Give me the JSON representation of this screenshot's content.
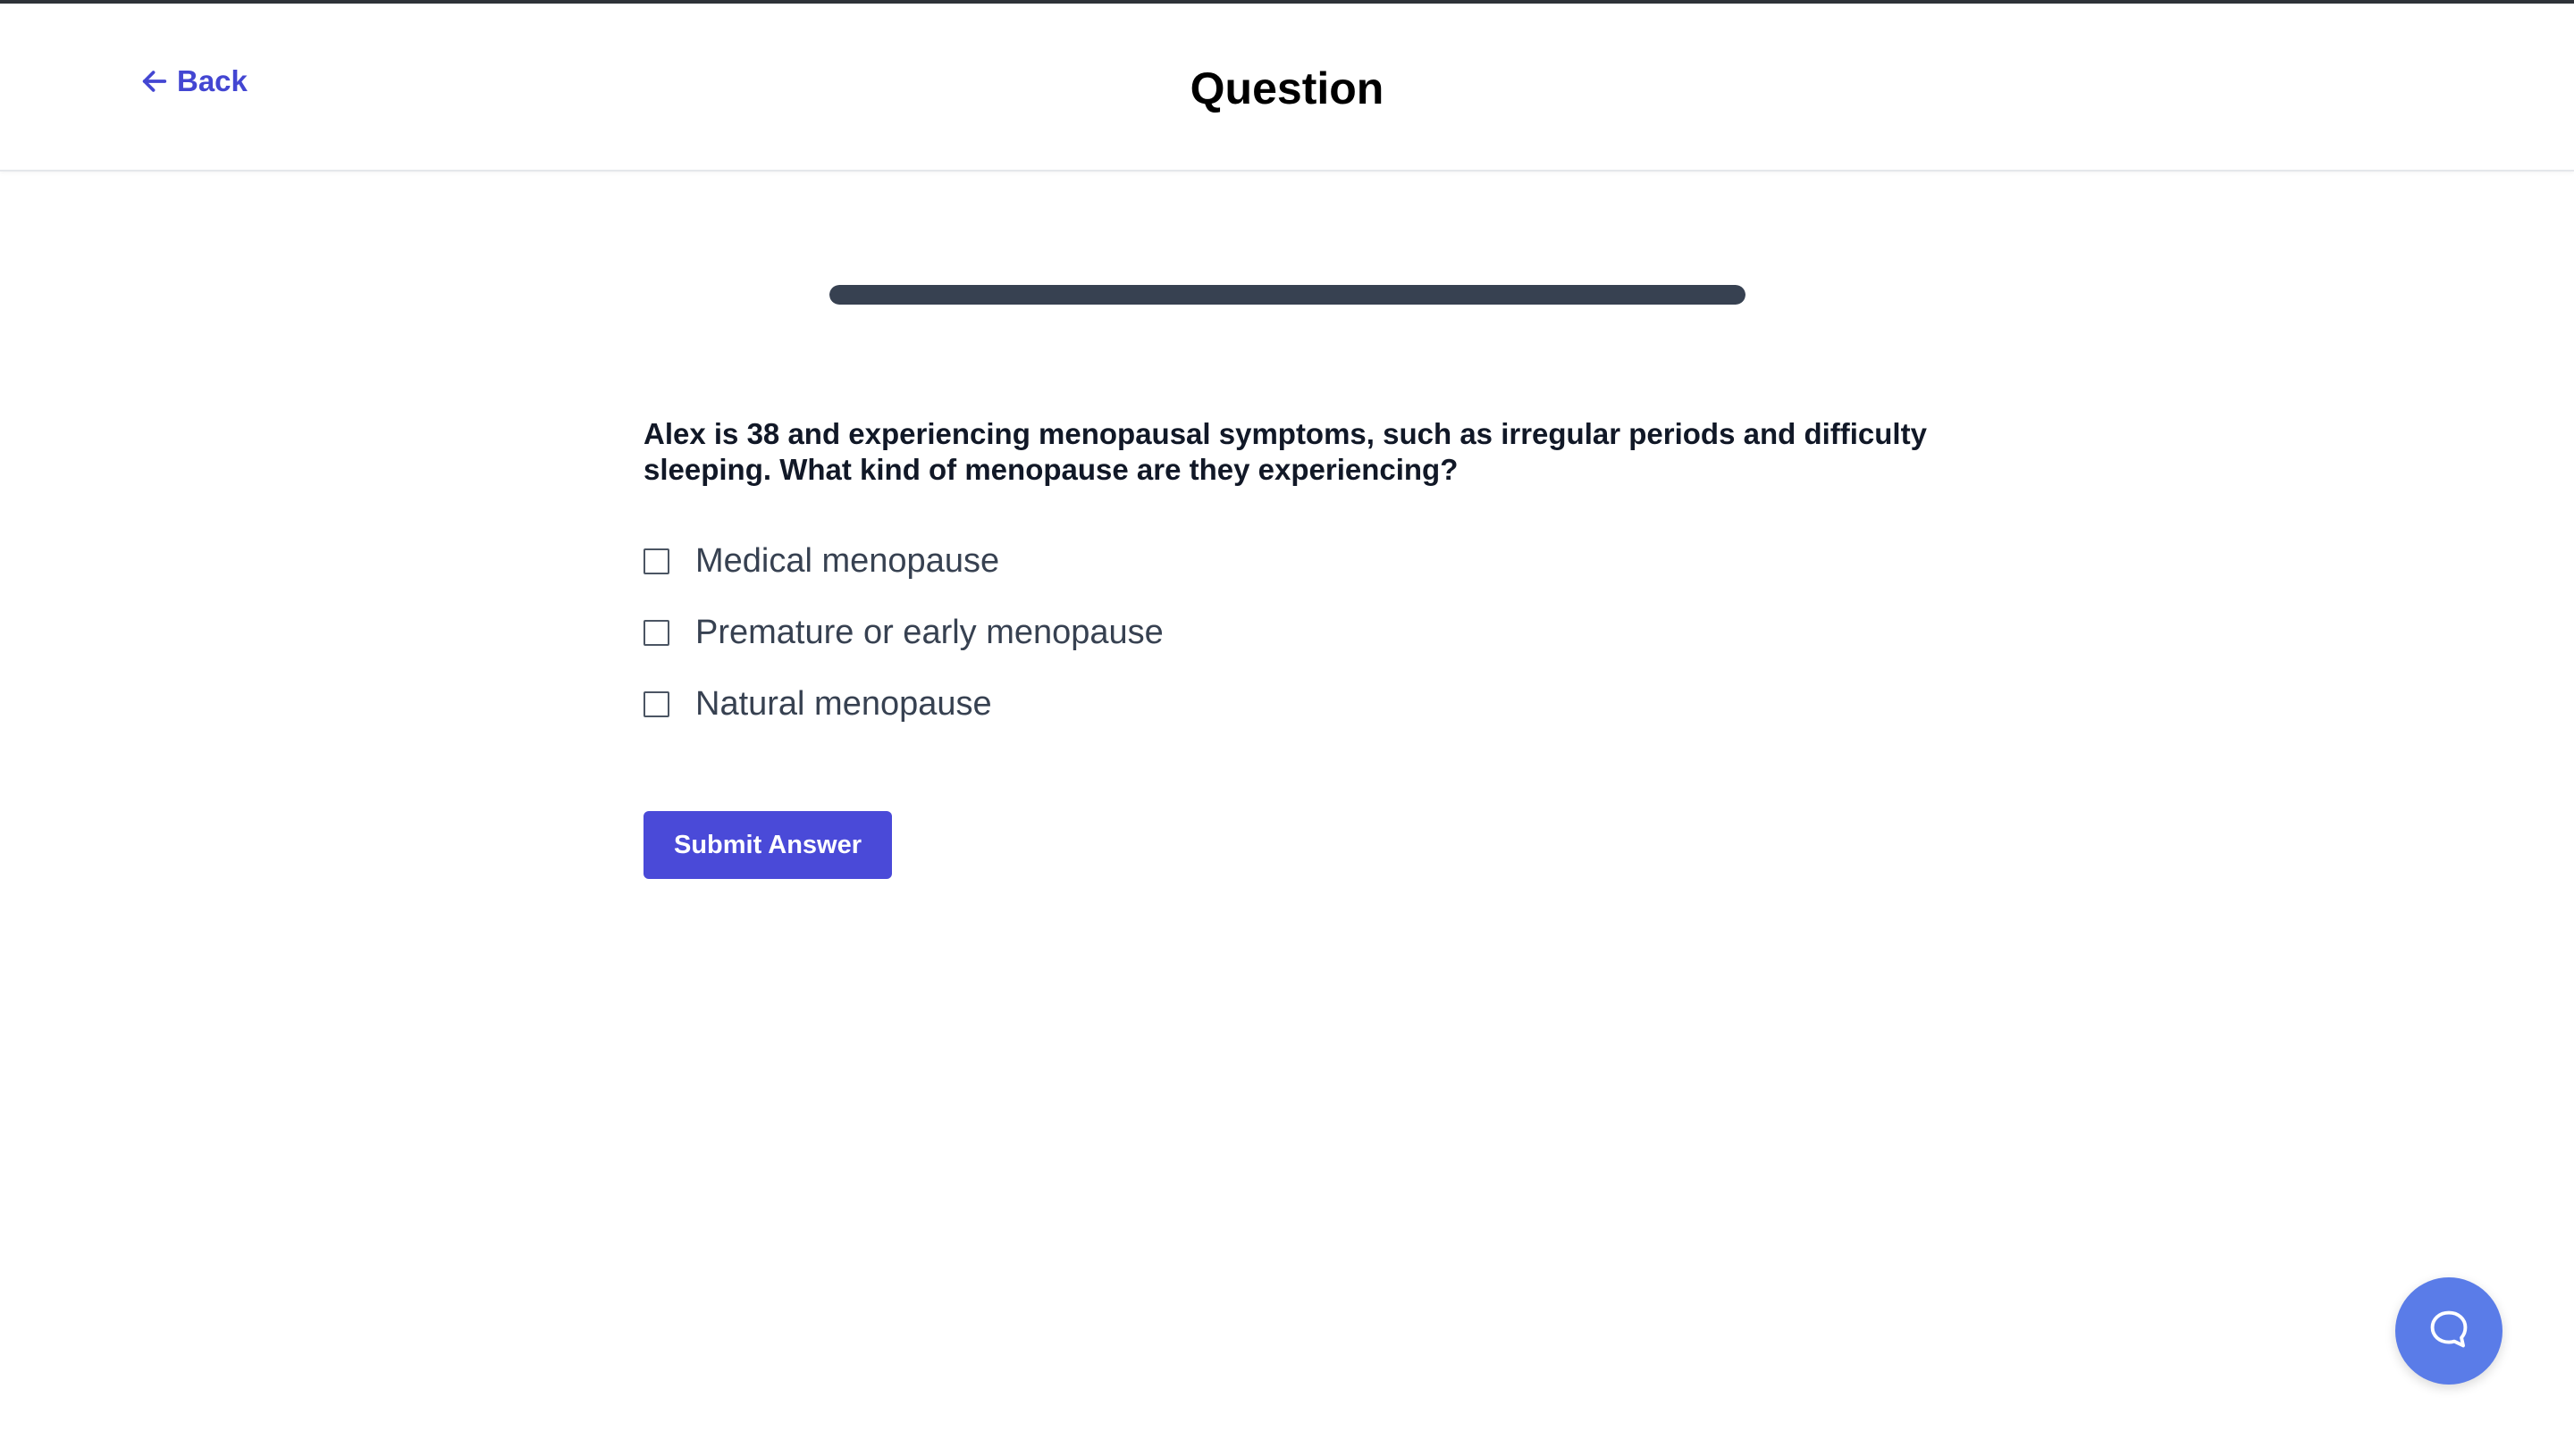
{
  "header": {
    "back_label": "Back",
    "title": "Question"
  },
  "progress": {
    "fraction": 1.0
  },
  "question": {
    "text": "Alex is 38 and experiencing menopausal symptoms, such as irregular periods and difficulty sleeping. What kind of menopause are they experiencing?",
    "options": [
      {
        "label": "Medical menopause",
        "checked": false
      },
      {
        "label": "Premature or early menopause",
        "checked": false
      },
      {
        "label": "Natural menopause",
        "checked": false
      }
    ]
  },
  "actions": {
    "submit_label": "Submit Answer"
  },
  "icons": {
    "back": "arrow-left-icon",
    "chat": "chat-bubble-icon"
  },
  "colors": {
    "accent": "#4a4ad8",
    "back_link": "#4346d2",
    "progress": "#374151",
    "chat_launcher": "#5a7ce8"
  }
}
